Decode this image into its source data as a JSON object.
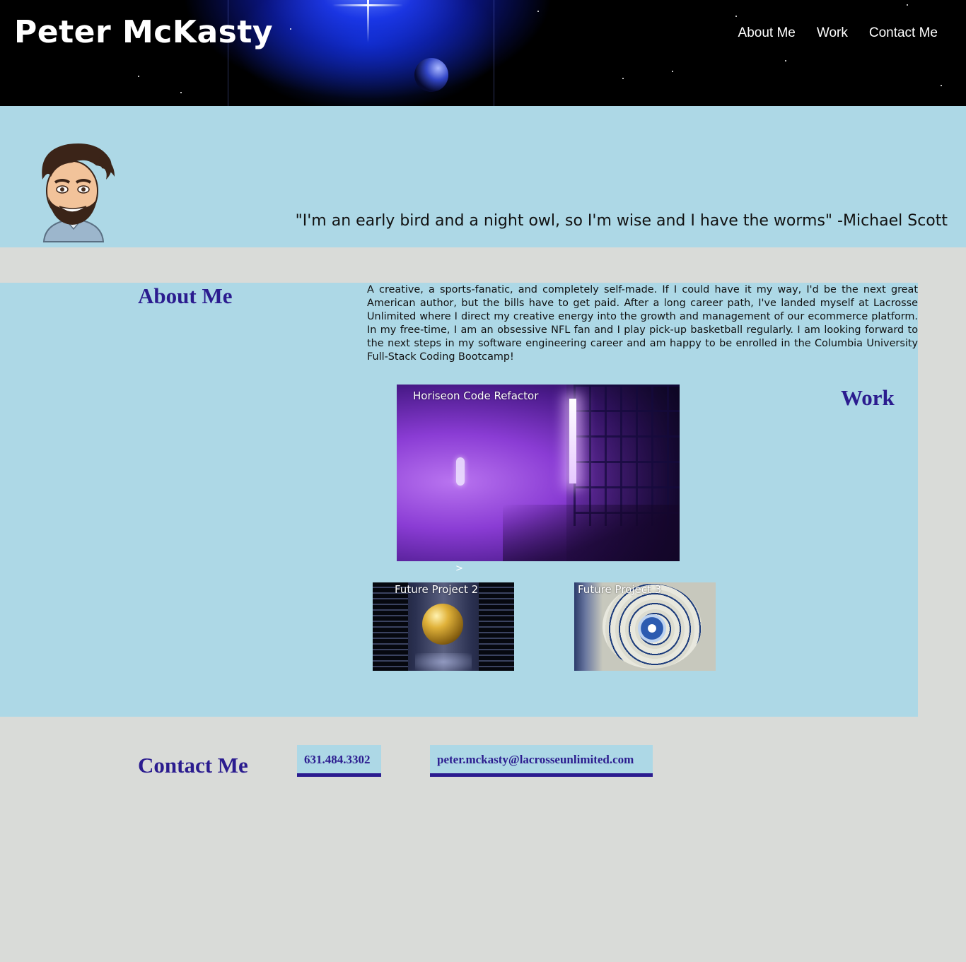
{
  "header": {
    "site_title": "Peter McKasty",
    "nav": [
      {
        "label": "About Me"
      },
      {
        "label": "Work"
      },
      {
        "label": "Contact Me"
      }
    ]
  },
  "hero": {
    "quote": "\"I'm an early bird and a night owl, so I'm wise and I have the worms\" -Michael Scott"
  },
  "about": {
    "heading": "About Me",
    "text": "A creative, a sports-fanatic, and completely self-made. If I could have it my way, I'd be the next great American author, but the bills have to get paid. After a long career path, I've landed myself at Lacrosse Unlimited where I direct my creative energy into the growth and management of our ecommerce platform. In my free-time, I am an obsessive NFL fan and I play pick-up basketball regularly. I am looking forward to the next steps in my software engineering career and am happy to be enrolled in the Columbia University Full-Stack Coding Bootcamp!"
  },
  "work": {
    "heading": "Work",
    "projects": [
      {
        "label": "Horiseon Code Refactor"
      },
      {
        "label": "Future Project 2"
      },
      {
        "label": "Future Project 3"
      }
    ],
    "arrow": ">"
  },
  "contact": {
    "heading": "Contact Me",
    "phone": "631.484.3302",
    "email": "peter.mckasty@lacrosseunlimited.com"
  },
  "colors": {
    "light_blue": "#add8e6",
    "heading_purple": "#2b1c8f",
    "page_gray": "#d9dbd8"
  }
}
